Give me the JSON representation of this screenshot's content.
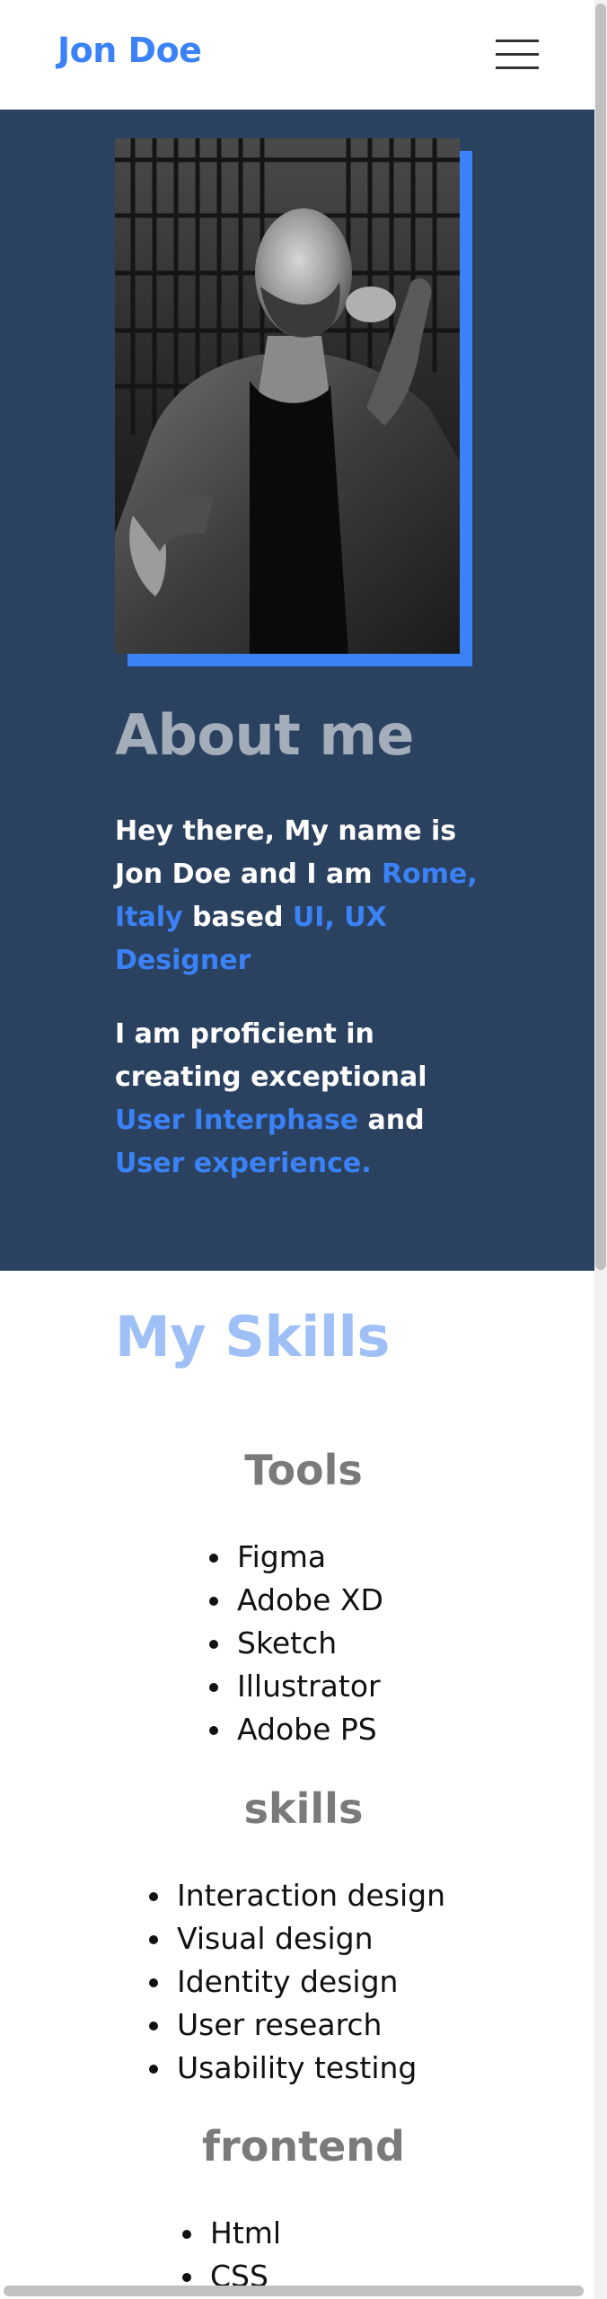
{
  "header": {
    "brand": "Jon Doe",
    "menu_icon": "hamburger-menu-icon"
  },
  "about": {
    "title": "About me",
    "paragraph1": {
      "t1": "Hey there, My name is Jon Doe and I am ",
      "h1": "Rome, Italy",
      "t2": " based ",
      "h2": "UI, UX Designer"
    },
    "paragraph2": {
      "t1": "I am proficient in creating exceptional ",
      "h1": "User Interphase",
      "t2": " and ",
      "h2": "User experience."
    }
  },
  "skills": {
    "title": "My Skills",
    "groups": [
      {
        "title": "Tools",
        "items": [
          "Figma",
          "Adobe XD",
          "Sketch",
          "Illustrator",
          "Adobe PS"
        ]
      },
      {
        "title": "skills",
        "items": [
          "Interaction design",
          "Visual design",
          "Identity design",
          "User research",
          "Usability testing"
        ]
      },
      {
        "title": "frontend",
        "items": [
          "Html",
          "CSS"
        ]
      }
    ]
  },
  "colors": {
    "accent": "#3b82f6",
    "about_bg": "#2b4160",
    "skills_title": "#9fc0f7"
  }
}
